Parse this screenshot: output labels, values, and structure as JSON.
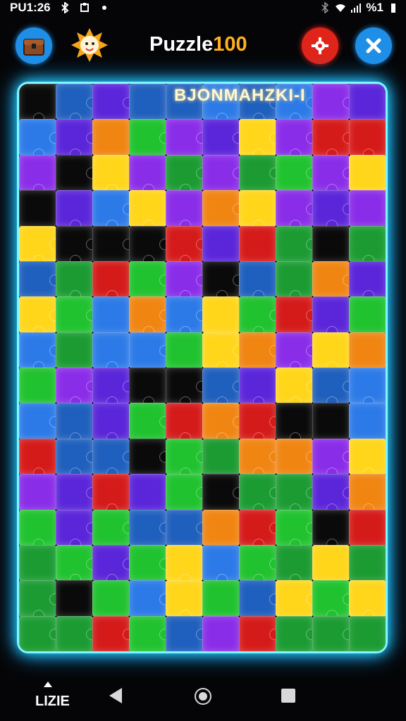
{
  "status_bar": {
    "time": "PU1:26",
    "battery": "%1"
  },
  "header": {
    "title_part1": "Puzzle",
    "title_part2": "100",
    "icons": [
      "chest-icon",
      "sun-icon",
      "gear-icon",
      "close-icon"
    ]
  },
  "board": {
    "label": "BJONMAHZKI-I"
  },
  "nav": {
    "home_label": "LIZIE",
    "icons": [
      "back-icon",
      "home-icon",
      "recents-icon"
    ]
  }
}
